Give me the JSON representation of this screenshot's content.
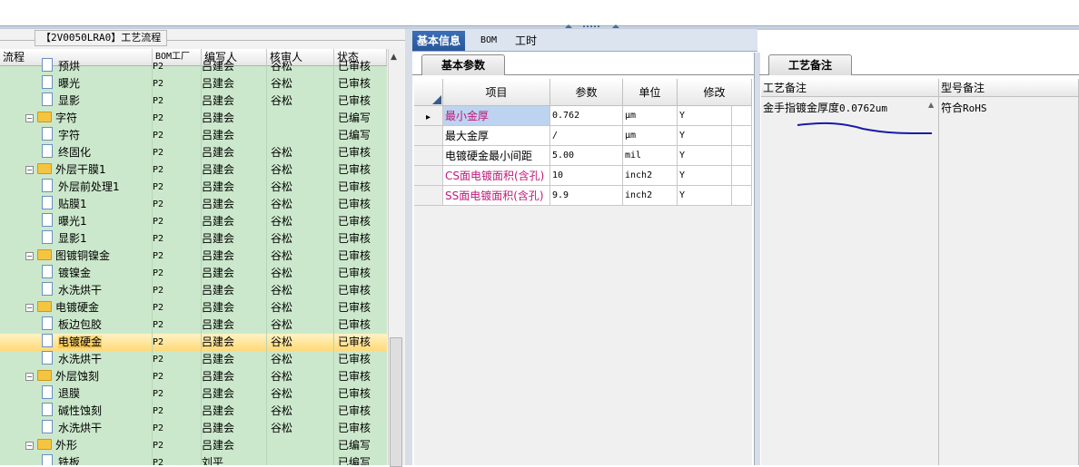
{
  "left": {
    "group_title": "【2V0050LRA0】工艺流程",
    "columns": [
      "流程",
      "BOM工厂",
      "编写人",
      "核审人",
      "状态"
    ],
    "rows": [
      {
        "indent": 2,
        "kind": "doc",
        "name": "预烘",
        "bom": "P2",
        "author": "吕建会",
        "reviewer": "谷松",
        "status": "已审核"
      },
      {
        "indent": 2,
        "kind": "doc",
        "name": "曝光",
        "bom": "P2",
        "author": "吕建会",
        "reviewer": "谷松",
        "status": "已审核"
      },
      {
        "indent": 2,
        "kind": "doc",
        "name": "显影",
        "bom": "P2",
        "author": "吕建会",
        "reviewer": "谷松",
        "status": "已审核"
      },
      {
        "indent": 1,
        "kind": "folder",
        "name": "字符",
        "bom": "P2",
        "author": "吕建会",
        "reviewer": "",
        "status": "已编写"
      },
      {
        "indent": 2,
        "kind": "doc",
        "name": "字符",
        "bom": "P2",
        "author": "吕建会",
        "reviewer": "",
        "status": "已编写"
      },
      {
        "indent": 2,
        "kind": "doc",
        "name": "终固化",
        "bom": "P2",
        "author": "吕建会",
        "reviewer": "谷松",
        "status": "已审核"
      },
      {
        "indent": 1,
        "kind": "folder",
        "name": "外层干膜1",
        "bom": "P2",
        "author": "吕建会",
        "reviewer": "谷松",
        "status": "已审核"
      },
      {
        "indent": 2,
        "kind": "doc",
        "name": "外层前处理1",
        "bom": "P2",
        "author": "吕建会",
        "reviewer": "谷松",
        "status": "已审核"
      },
      {
        "indent": 2,
        "kind": "doc",
        "name": "贴膜1",
        "bom": "P2",
        "author": "吕建会",
        "reviewer": "谷松",
        "status": "已审核"
      },
      {
        "indent": 2,
        "kind": "doc",
        "name": "曝光1",
        "bom": "P2",
        "author": "吕建会",
        "reviewer": "谷松",
        "status": "已审核"
      },
      {
        "indent": 2,
        "kind": "doc",
        "name": "显影1",
        "bom": "P2",
        "author": "吕建会",
        "reviewer": "谷松",
        "status": "已审核"
      },
      {
        "indent": 1,
        "kind": "folder",
        "name": "图镀铜镍金",
        "bom": "P2",
        "author": "吕建会",
        "reviewer": "谷松",
        "status": "已审核"
      },
      {
        "indent": 2,
        "kind": "doc",
        "name": "镀镍金",
        "bom": "P2",
        "author": "吕建会",
        "reviewer": "谷松",
        "status": "已审核"
      },
      {
        "indent": 2,
        "kind": "doc",
        "name": "水洗烘干",
        "bom": "P2",
        "author": "吕建会",
        "reviewer": "谷松",
        "status": "已审核"
      },
      {
        "indent": 1,
        "kind": "folder",
        "name": "电镀硬金",
        "bom": "P2",
        "author": "吕建会",
        "reviewer": "谷松",
        "status": "已审核"
      },
      {
        "indent": 2,
        "kind": "doc",
        "name": "板边包胶",
        "bom": "P2",
        "author": "吕建会",
        "reviewer": "谷松",
        "status": "已审核"
      },
      {
        "indent": 2,
        "kind": "doc",
        "name": "电镀硬金",
        "bom": "P2",
        "author": "吕建会",
        "reviewer": "谷松",
        "status": "已审核",
        "selected": true
      },
      {
        "indent": 2,
        "kind": "doc",
        "name": "水洗烘干",
        "bom": "P2",
        "author": "吕建会",
        "reviewer": "谷松",
        "status": "已审核"
      },
      {
        "indent": 1,
        "kind": "folder",
        "name": "外层蚀刻",
        "bom": "P2",
        "author": "吕建会",
        "reviewer": "谷松",
        "status": "已审核"
      },
      {
        "indent": 2,
        "kind": "doc",
        "name": "退膜",
        "bom": "P2",
        "author": "吕建会",
        "reviewer": "谷松",
        "status": "已审核"
      },
      {
        "indent": 2,
        "kind": "doc",
        "name": "碱性蚀刻",
        "bom": "P2",
        "author": "吕建会",
        "reviewer": "谷松",
        "status": "已审核"
      },
      {
        "indent": 2,
        "kind": "doc",
        "name": "水洗烘干",
        "bom": "P2",
        "author": "吕建会",
        "reviewer": "谷松",
        "status": "已审核"
      },
      {
        "indent": 1,
        "kind": "folder",
        "name": "外形",
        "bom": "P2",
        "author": "吕建会",
        "reviewer": "",
        "status": "已编写"
      },
      {
        "indent": 2,
        "kind": "doc",
        "name": "铣板",
        "bom": "P2",
        "author": "刘平",
        "reviewer": "",
        "status": "已编写"
      }
    ]
  },
  "middle": {
    "tabs": [
      "基本信息",
      "BOM",
      "工时"
    ],
    "subtab": "基本参数",
    "columns": [
      "项目",
      "参数",
      "单位",
      "修改"
    ],
    "rows": [
      {
        "item": "最小金厚",
        "value": "0.762",
        "unit": "μm",
        "mod": "Y",
        "color": "#c0187a",
        "current": true
      },
      {
        "item": "最大金厚",
        "value": "/",
        "unit": "μm",
        "mod": "Y",
        "color": "#000000"
      },
      {
        "item": "电镀硬金最小间距",
        "value": "5.00",
        "unit": "mil",
        "mod": "Y",
        "color": "#000000"
      },
      {
        "item": "CS面电镀面积(含孔)",
        "value": "10",
        "unit": "inch2",
        "mod": "Y",
        "color": "#c0187a"
      },
      {
        "item": "SS面电镀面积(含孔)",
        "value": "9.9",
        "unit": "inch2",
        "mod": "Y",
        "color": "#c0187a"
      }
    ]
  },
  "right": {
    "tab": "工艺备注",
    "columns": [
      "工艺备注",
      "型号备注"
    ],
    "process_note_cjk": "金手指镀金厚度",
    "process_note_val": "0.0762um",
    "model_note_cjk": "符合",
    "model_note_val": "RoHS"
  },
  "colors": {
    "tree_bg": "#cce8cc",
    "selection": "#ffd978",
    "active_tab": "#2f62a8",
    "highlight_text": "#c0187a",
    "annotation_stroke": "#1a1aa8"
  }
}
